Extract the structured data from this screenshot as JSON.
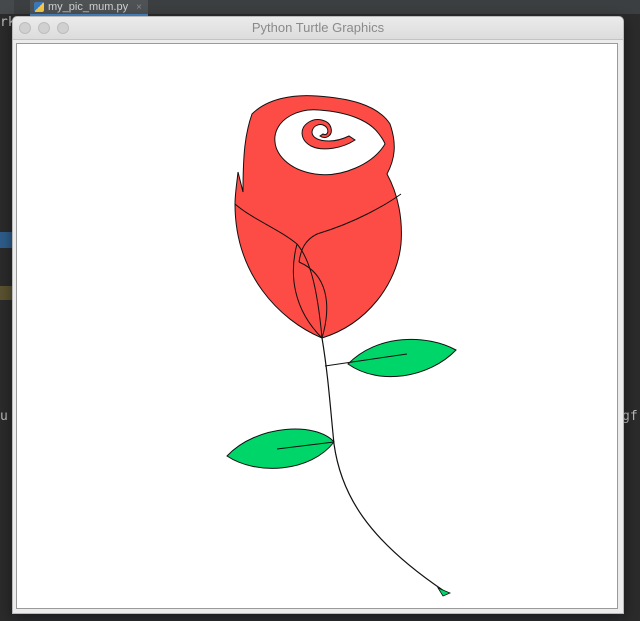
{
  "ide": {
    "tab_label": "my_pic_mum.py",
    "tab_close": "×",
    "left_partial_1": "rk",
    "left_partial_2": "u",
    "right_partial": "gf"
  },
  "window": {
    "title": "Python Turtle Graphics"
  },
  "drawing": {
    "colors": {
      "petal_fill": "#fd4b45",
      "leaf_fill": "#00d56a",
      "outline": "#111111",
      "canvas": "#ffffff"
    }
  }
}
